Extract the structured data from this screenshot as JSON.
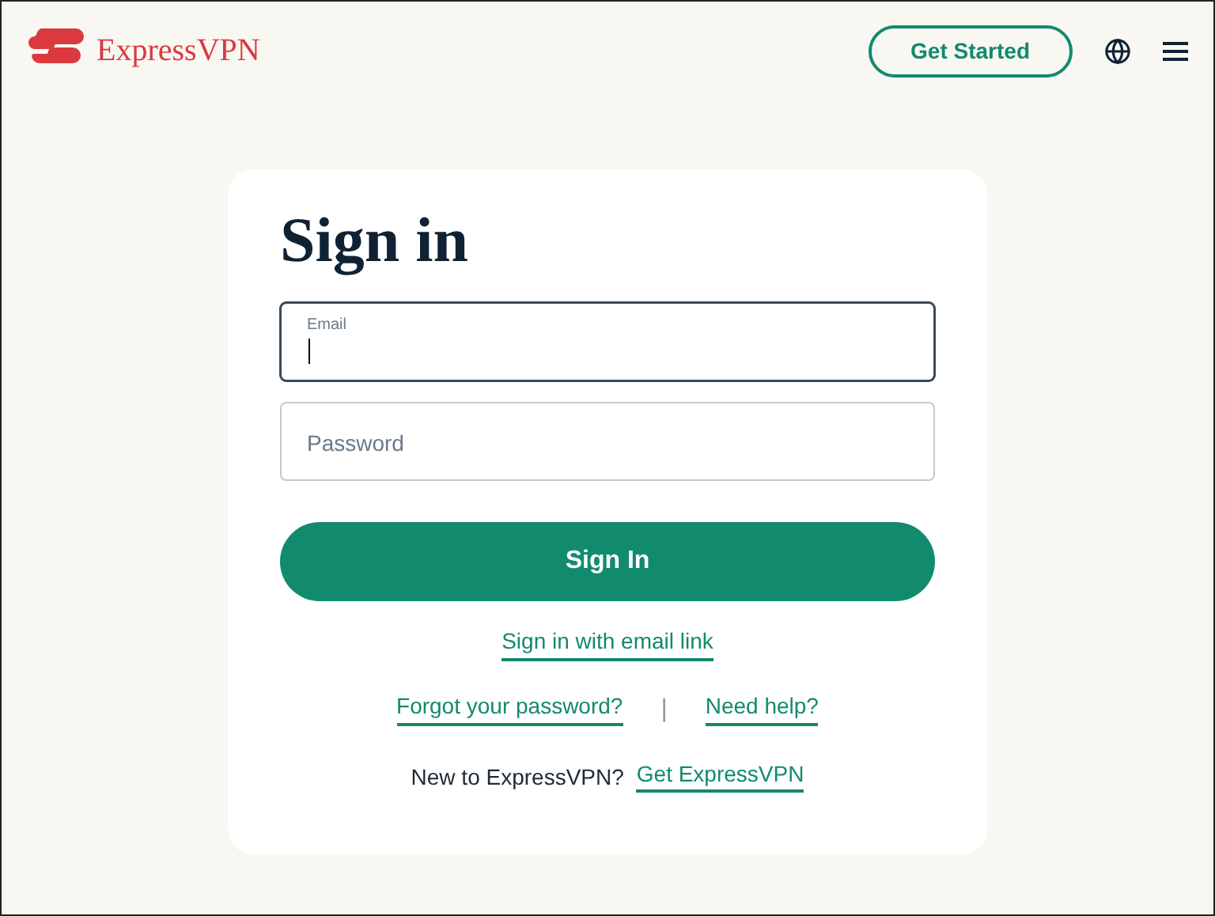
{
  "header": {
    "logo_text": "ExpressVPN",
    "cta": "Get Started"
  },
  "card": {
    "title": "Sign in",
    "fields": [
      {
        "label": "Email",
        "focused": true
      },
      {
        "placeholder": "Password",
        "focused": false
      }
    ],
    "submit": "Sign In",
    "email_link": "Sign in with email link",
    "help_links": [
      "Forgot your password?",
      "Need help?"
    ],
    "separator": "|",
    "signup_prompt": "New to ExpressVPN?",
    "signup_link": "Get ExpressVPN"
  }
}
